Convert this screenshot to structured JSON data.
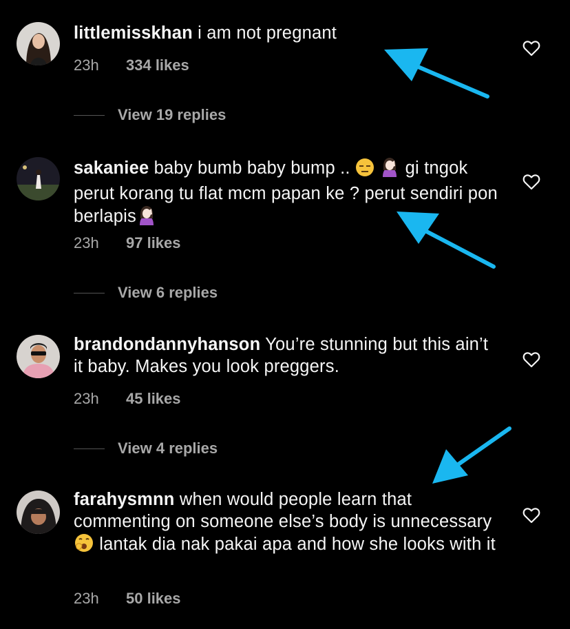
{
  "comments": [
    {
      "username": "littlemisskhan",
      "text_parts": [
        " i am not pregnant"
      ],
      "time": "23h",
      "likes": "334 likes",
      "replies": "View 19 replies"
    },
    {
      "username": "sakaniee",
      "text_parts": [
        " baby bumb baby bump .. ",
        " gi tngok perut korang tu flat mcm papan ke ? perut sendiri pon berlapis"
      ],
      "emoji": [
        "expressionless-face-emoji",
        "woman-facepalming-emoji",
        "woman-facepalming-emoji"
      ],
      "time": "23h",
      "likes": "97 likes",
      "replies": "View 6 replies"
    },
    {
      "username": "brandondannyhanson",
      "text_parts": [
        " You’re stunning but this ain’t it baby. Makes you look preggers."
      ],
      "time": "23h",
      "likes": "45 likes",
      "replies": "View 4 replies"
    },
    {
      "username": "farahysmnn",
      "text_parts": [
        " when would people learn that commenting on someone else’s body is unnecessary ",
        " lantak dia nak pakai apa and how she looks with it"
      ],
      "emoji": [
        "yawning-face-emoji"
      ],
      "time": "23h",
      "likes": "50 likes"
    }
  ],
  "colors": {
    "background": "#000000",
    "text": "#f5f5f5",
    "secondary": "#a8a8a8",
    "annotation_arrow": "#1ab7f0"
  },
  "icons": [
    "heart-icon",
    "annotation-arrow"
  ]
}
